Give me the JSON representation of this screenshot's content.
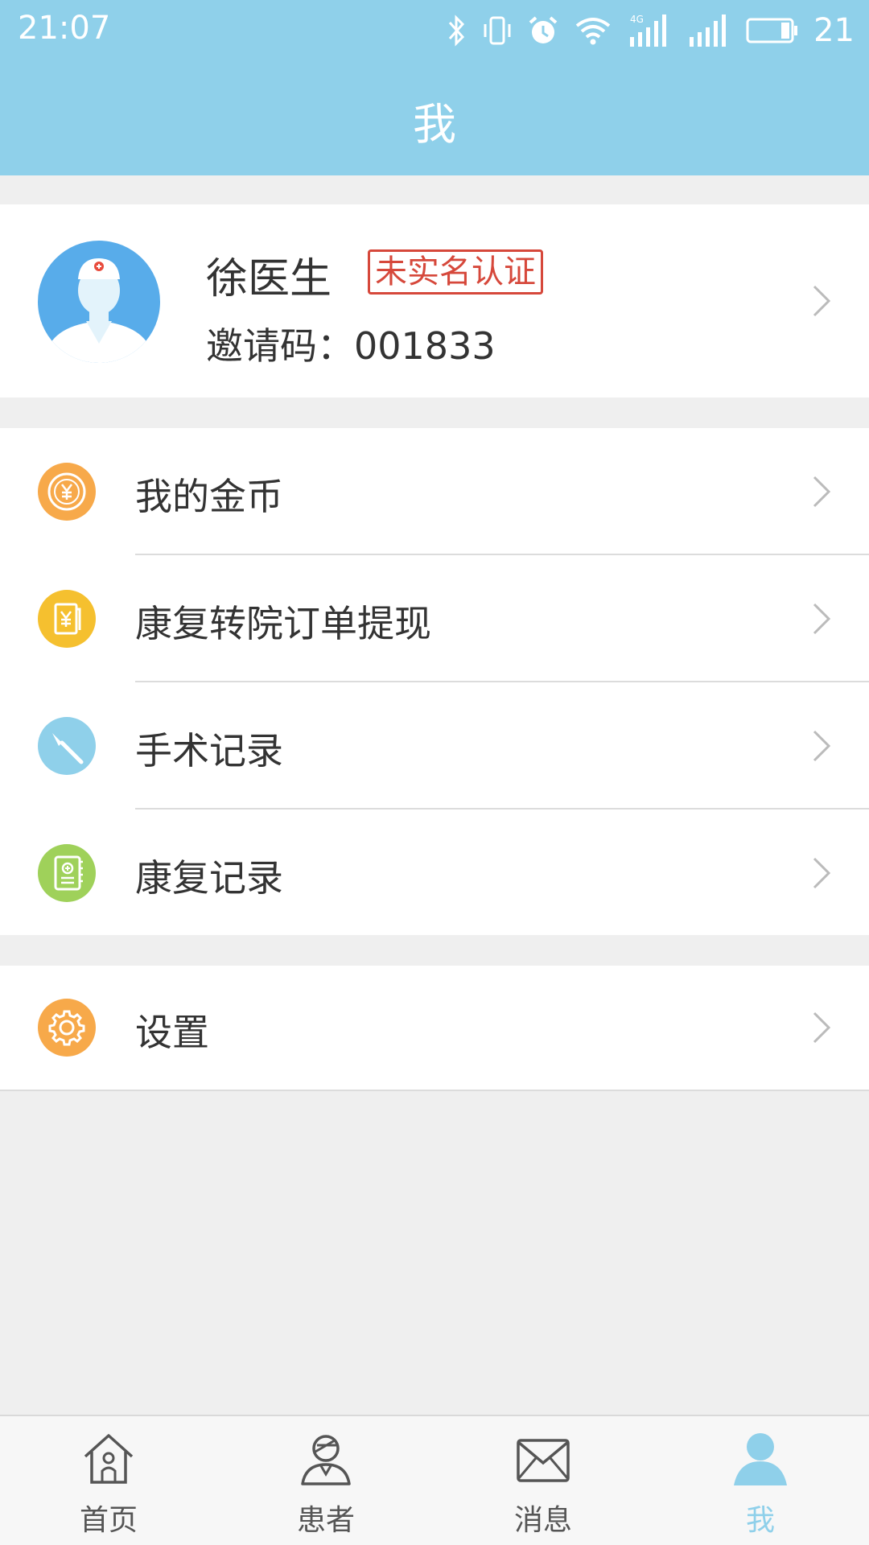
{
  "status_bar": {
    "time": "21:07",
    "battery": "21",
    "network": "4G"
  },
  "header": {
    "title": "我"
  },
  "profile": {
    "name": "徐医生",
    "verify_badge": "未实名认证",
    "invite_label": "邀请码：",
    "invite_code": "001833"
  },
  "menu": {
    "items": [
      {
        "label": "我的金币",
        "icon": "coin-icon",
        "color": "#f7a94a"
      },
      {
        "label": "康复转院订单提现",
        "icon": "withdraw-icon",
        "color": "#f5c02f"
      },
      {
        "label": "手术记录",
        "icon": "scalpel-icon",
        "color": "#8fd0ea"
      },
      {
        "label": "康复记录",
        "icon": "record-book-icon",
        "color": "#9fd15a"
      }
    ],
    "settings": {
      "label": "设置",
      "icon": "gear-icon",
      "color": "#f7a94a"
    }
  },
  "tabbar": {
    "tabs": [
      {
        "label": "首页",
        "icon": "home-icon"
      },
      {
        "label": "患者",
        "icon": "patient-icon"
      },
      {
        "label": "消息",
        "icon": "mail-icon"
      },
      {
        "label": "我",
        "icon": "person-icon",
        "active": true
      }
    ]
  },
  "colors": {
    "primary": "#8fd0ea",
    "badge_red": "#d6483b",
    "background": "#efefef"
  }
}
